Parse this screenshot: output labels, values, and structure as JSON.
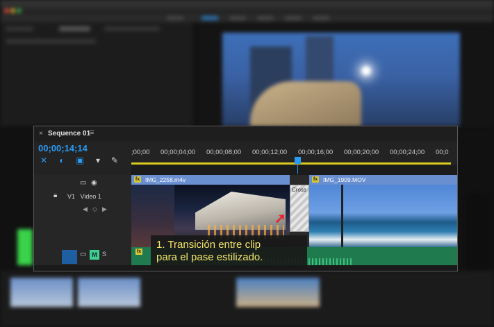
{
  "panel": {
    "title": "Sequence 01",
    "close_glyph": "×",
    "menu_glyph": "≡",
    "timecode": "00;00;14;14"
  },
  "ruler": {
    "ticks": [
      ";00;00",
      "00;00;04;00",
      "00;00;08;00",
      "00;00;12;00",
      "00;00;16;00",
      "00;00;20;00",
      "00;00;24;00",
      "00;0"
    ]
  },
  "tracks": {
    "video": {
      "name": "V1",
      "label": "Video 1"
    },
    "audio": {
      "mute": "M",
      "solo": "S"
    }
  },
  "clips": {
    "a": {
      "name": "IMG_2258.m4v"
    },
    "transition": {
      "name": "Cross"
    },
    "b": {
      "name": "IMG_1909.MOV"
    }
  },
  "caption": {
    "line1": "1. Transición entre clip",
    "line2": "para el pase estilizado."
  },
  "icons": [
    "snap-icon",
    "linked-selection-icon",
    "add-marker-icon",
    "marker-icon",
    "wrench-icon",
    "camera-icon",
    "eye-icon",
    "lock-icon",
    "fx-icon"
  ],
  "colors": {
    "accent": "#2b9af3",
    "clip_label": "#6a8fd1",
    "audio_clip": "#1f7a4d",
    "caption_text": "#f2e66a",
    "work_area": "#d9c91e"
  }
}
